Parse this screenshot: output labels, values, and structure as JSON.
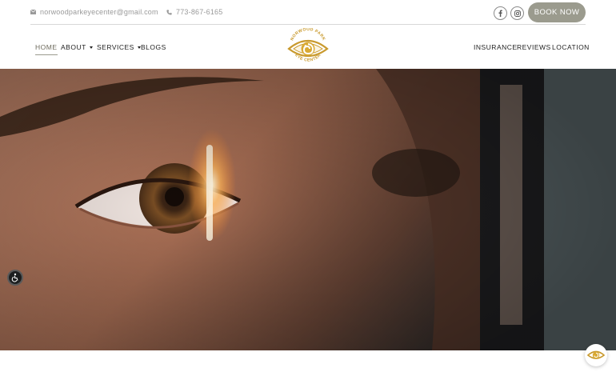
{
  "topbar": {
    "email": "norwoodparkeyecenter@gmail.com",
    "phone": "773-867-6165",
    "email_icon": "envelope-icon",
    "phone_icon": "phone-icon",
    "social": [
      {
        "name": "facebook",
        "icon": "facebook-icon"
      },
      {
        "name": "instagram",
        "icon": "instagram-icon"
      }
    ],
    "book_label": "BOOK NOW"
  },
  "nav": {
    "left": [
      {
        "label": "HOME",
        "active": true
      },
      {
        "label": "ABOUT",
        "dropdown": true
      },
      {
        "label": "SERVICES",
        "dropdown": true
      },
      {
        "label": "BLOGS"
      }
    ],
    "right": [
      {
        "label": "INSURANCE"
      },
      {
        "label": "REVIEWS"
      },
      {
        "label": "LOCATION"
      }
    ],
    "logo_text_top": "NORWOOD PARK",
    "logo_text_bottom": "EYE CENTER"
  },
  "colors": {
    "accent": "#9b9b8e",
    "logo_gold": "#c99a2e",
    "text": "#1e1e1e",
    "muted": "#9a9a9a"
  },
  "widgets": {
    "accessibility_icon": "accessibility-icon",
    "chat_icon": "chat-logo-icon"
  }
}
